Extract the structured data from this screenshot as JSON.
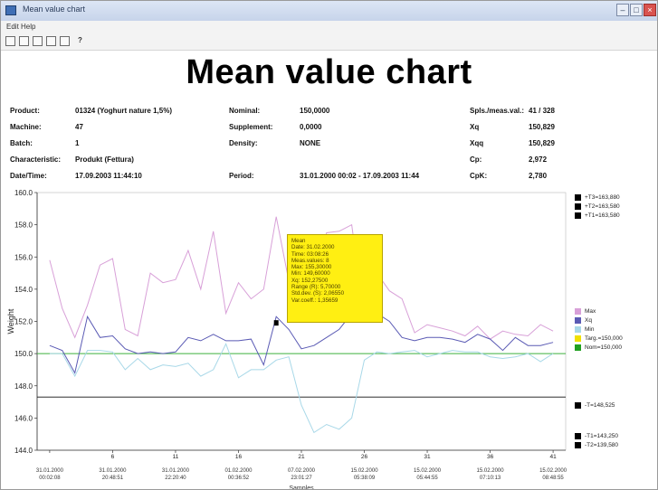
{
  "window": {
    "title": "Mean value chart"
  },
  "menu": [
    "Edit",
    "Help"
  ],
  "toolbar": {
    "help_label": "?"
  },
  "chart_title": "Mean value chart",
  "info": {
    "product_label": "Product:",
    "product_value": "01324 (Yoghurt nature 1,5%)",
    "machine_label": "Machine:",
    "machine_value": "47",
    "batch_label": "Batch:",
    "batch_value": "1",
    "characteristic_label": "Characteristic:",
    "characteristic_value": "Produkt (Fettura)",
    "datetime_label": "Date/Time:",
    "datetime_value": "17.09.2003 11:44:10",
    "nominal_label": "Nominal:",
    "nominal_value": "150,0000",
    "supplement_label": "Supplement:",
    "supplement_value": "0,0000",
    "density_label": "Density:",
    "density_value": "NONE",
    "period_label": "Period:",
    "period_value": "31.01.2000 00:02 - 17.09.2003 11:44",
    "spls_label": "Spls./meas.val.:",
    "spls_value": "41 / 328",
    "xq_label": "Xq",
    "xq_value": "150,829",
    "xqq_label": "Xqq",
    "xqq_value": "150,829",
    "cp_label": "Cp:",
    "cp_value": "2,972",
    "cpk_label": "CpK:",
    "cpk_value": "2,780"
  },
  "tooltip": {
    "title": "Mean",
    "lines": [
      "Date: 31.02.2000",
      "Time: 03:08:26",
      "Meas.values: 8",
      "Max: 155,30000",
      "Min: 149,60000",
      "Xq: 152,27500",
      "Range (R): 5,70000",
      "Std.dev. (S): 2,06550",
      "Var.coeff.: 1,35659"
    ]
  },
  "legend": {
    "limits": [
      "+T3=163,880",
      "+T2=163,580",
      "+T1=163,580"
    ],
    "series": [
      {
        "label": "Max",
        "color": "#d8a0d8"
      },
      {
        "label": "Xq",
        "color": "#5a5ab4"
      },
      {
        "label": "Min",
        "color": "#a8d8e8"
      },
      {
        "label": "Targ.=150,000",
        "color": "#f0e000"
      },
      {
        "label": "Nom=150,000",
        "color": "#20a020"
      }
    ],
    "lower_limits": [
      "-T=148,525",
      "-T1=143,250",
      "-T2=139,580"
    ]
  },
  "colors": {
    "max": "#d8a0d8",
    "mean": "#5a5ab4",
    "min": "#a8d8e8",
    "nominal": "#3cb03c",
    "limit": "#111111"
  },
  "chart_data": {
    "type": "line",
    "ylabel": "Weight",
    "xlabel": "Samples",
    "ylim": [
      144,
      160
    ],
    "yticks": [
      "160.0",
      "158.0",
      "156.0",
      "154.0",
      "152.0",
      "150.0",
      "148.0",
      "146.0",
      "144.0"
    ],
    "xticks": [
      {
        "x": 1,
        "num": "",
        "l1": "31.01.2000",
        "l2": "00:02:08"
      },
      {
        "x": 6,
        "num": "6",
        "l1": "31.01.2000",
        "l2": "20:48:51"
      },
      {
        "x": 11,
        "num": "11",
        "l1": "31.01.2000",
        "l2": "22:20:40"
      },
      {
        "x": 16,
        "num": "16",
        "l1": "01.02.2000",
        "l2": "00:36:52"
      },
      {
        "x": 21,
        "num": "21",
        "l1": "07.02.2000",
        "l2": "23:01:27"
      },
      {
        "x": 26,
        "num": "26",
        "l1": "15.02.2000",
        "l2": "05:38:09"
      },
      {
        "x": 31,
        "num": "31",
        "l1": "15.02.2000",
        "l2": "05:44:55"
      },
      {
        "x": 36,
        "num": "36",
        "l1": "15.02.2000",
        "l2": "07:10:13"
      },
      {
        "x": 41,
        "num": "41",
        "l1": "15.02.2000",
        "l2": "08:48:55"
      }
    ],
    "nominal": 150.0,
    "lower_limit": 147.3,
    "series": [
      {
        "name": "Max",
        "values": [
          155.8,
          152.8,
          151.0,
          153.0,
          155.5,
          155.9,
          151.5,
          151.1,
          155.0,
          154.4,
          154.6,
          156.4,
          154.0,
          157.6,
          152.5,
          154.4,
          153.4,
          154.0,
          158.5,
          154.5,
          155.5,
          154.3,
          157.5,
          157.6,
          158.0,
          152.2,
          155.0,
          153.9,
          153.4,
          151.3,
          151.8,
          151.6,
          151.4,
          151.1,
          151.7,
          150.9,
          151.4,
          151.2,
          151.1,
          151.8,
          151.4
        ]
      },
      {
        "name": "Xq",
        "values": [
          150.5,
          150.2,
          148.8,
          152.3,
          151.0,
          151.1,
          150.3,
          150.0,
          150.1,
          150.0,
          150.1,
          151.0,
          150.8,
          151.2,
          150.8,
          150.8,
          150.9,
          149.3,
          152.3,
          151.5,
          150.3,
          150.5,
          151.0,
          151.5,
          152.5,
          154.5,
          152.5,
          152.0,
          151.0,
          150.8,
          151.0,
          151.0,
          150.9,
          150.7,
          151.2,
          150.9,
          150.2,
          151.0,
          150.5,
          150.5,
          150.7
        ]
      },
      {
        "name": "Min",
        "values": [
          150.0,
          150.0,
          148.6,
          150.2,
          150.2,
          150.1,
          149.0,
          149.7,
          149.0,
          149.3,
          149.2,
          149.4,
          148.6,
          149.0,
          150.6,
          148.5,
          149.0,
          149.0,
          149.6,
          149.8,
          146.8,
          145.1,
          145.6,
          145.3,
          146.0,
          149.6,
          150.1,
          150.0,
          150.1,
          150.2,
          149.8,
          150.0,
          150.2,
          150.1,
          150.1,
          149.8,
          149.7,
          149.8,
          150.0,
          149.5,
          150.0
        ]
      }
    ]
  }
}
